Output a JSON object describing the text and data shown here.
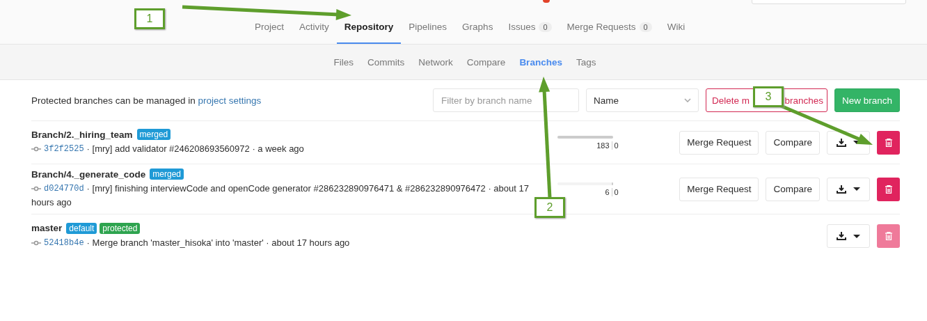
{
  "nav_tabs": [
    {
      "label": "Project",
      "selected": false
    },
    {
      "label": "Activity",
      "selected": false
    },
    {
      "label": "Repository",
      "selected": true
    },
    {
      "label": "Pipelines",
      "selected": false
    },
    {
      "label": "Graphs",
      "selected": false
    },
    {
      "label": "Issues",
      "count": "0",
      "selected": false
    },
    {
      "label": "Merge Requests",
      "count": "0",
      "selected": false
    },
    {
      "label": "Wiki",
      "selected": false
    }
  ],
  "sub_tabs": [
    {
      "label": "Files",
      "selected": false
    },
    {
      "label": "Commits",
      "selected": false
    },
    {
      "label": "Network",
      "selected": false
    },
    {
      "label": "Compare",
      "selected": false
    },
    {
      "label": "Branches",
      "selected": true
    },
    {
      "label": "Tags",
      "selected": false
    }
  ],
  "toolbar": {
    "note": "Protected branches can be managed in",
    "note_link": "project settings",
    "filter_placeholder": "Filter by branch name",
    "sort": "Name",
    "delete_merged": [
      "Delete m",
      "branches"
    ],
    "new_branch": "New branch"
  },
  "branches": [
    {
      "name": "Branch/2._hiring_team",
      "badges": [
        {
          "label": "merged",
          "kind": "info"
        }
      ],
      "sha": "3f2f2525",
      "message_lines": [
        "· [mry] add validator #246208693560972 · a week ago"
      ],
      "divergence": {
        "behind": "183",
        "ahead": "0",
        "level": 1
      },
      "actions": [
        "Merge Request",
        "Compare"
      ],
      "delete_disabled": false
    },
    {
      "name": "Branch/4._generate_code",
      "badges": [
        {
          "label": "merged",
          "kind": "info"
        }
      ],
      "sha": "d024770d",
      "message_lines": [
        "· [mry] finishing interviewCode and openCode generator #286232890976471 & #286232890976472 · about 17",
        "hours ago"
      ],
      "divergence": {
        "behind": "6",
        "ahead": "0",
        "level": 0.03
      },
      "actions": [
        "Merge Request",
        "Compare"
      ],
      "delete_disabled": false
    },
    {
      "name": "master",
      "badges": [
        {
          "label": "default",
          "kind": "info"
        },
        {
          "label": "protected",
          "kind": "success"
        }
      ],
      "sha": "52418b4e",
      "message_lines": [
        "· Merge branch 'master_hisoka' into 'master' · about 17 hours ago"
      ],
      "delete_disabled": true
    }
  ],
  "callouts": [
    {
      "label": "1"
    },
    {
      "label": "2"
    },
    {
      "label": "3"
    }
  ]
}
